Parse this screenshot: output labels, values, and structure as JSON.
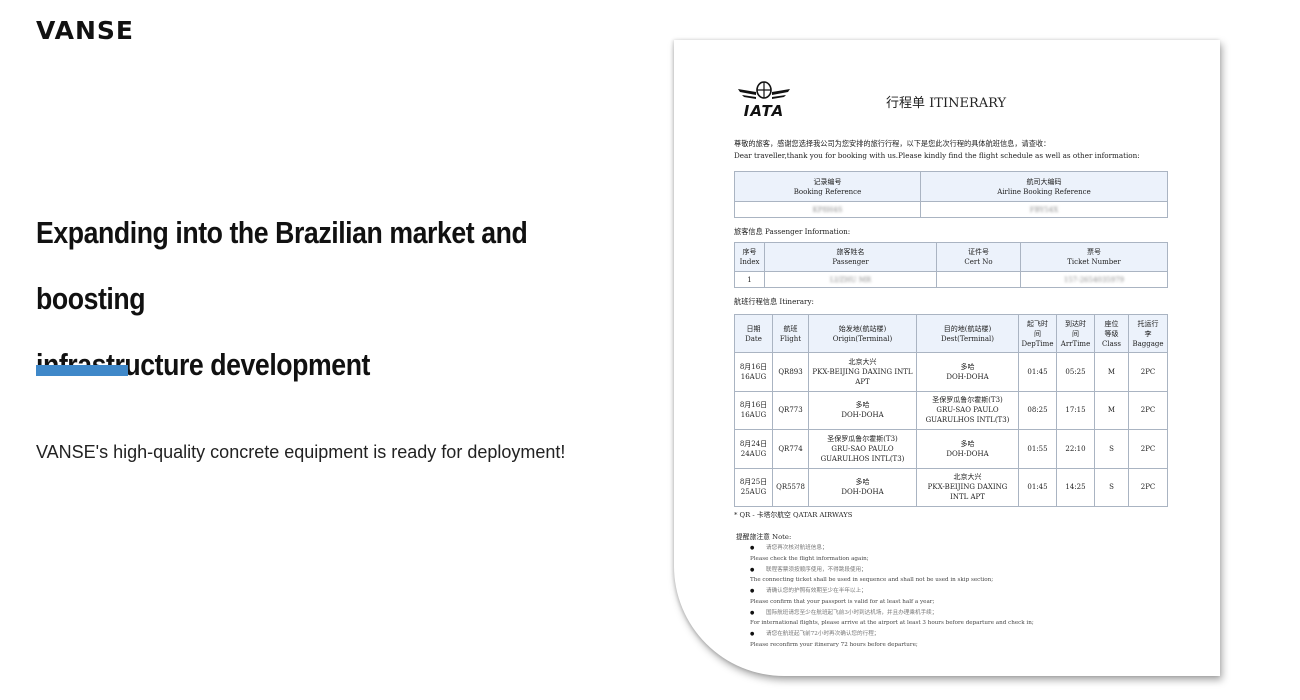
{
  "brand": {
    "logo_text": "VANSE"
  },
  "headline": {
    "line1": "Expanding into the Brazilian market and boosting",
    "line2": "infrastructure development"
  },
  "tagline": "VANSE's high-quality concrete equipment is ready for deployment!",
  "accent_color": "#3f88c9",
  "document": {
    "iata_text": "IATA",
    "title": "行程单  ITINERARY",
    "greeting_zh": "尊敬的旅客，感谢您选择我公司为您安排的旅行行程，以下是您此次行程的具体航班信息，请查收：",
    "greeting_en": "Dear traveller,thank you for booking with us.Please kindly find the flight schedule as well as other information:",
    "booking": {
      "col1_zh": "记录编号",
      "col1_en": "Booking Reference",
      "col2_zh": "航司大编码",
      "col2_en": "Airline Booking Reference",
      "val1": "KP8H4S",
      "val2": "FBY54X"
    },
    "passenger_section": "旅客信息  Passenger Information:",
    "passenger": {
      "h1_zh": "序号",
      "h1_en": "Index",
      "h2_zh": "旅客姓名",
      "h2_en": "Passenger",
      "h3_zh": "证件号",
      "h3_en": "Cert No",
      "h4_zh": "票号",
      "h4_en": "Ticket Number",
      "index": "1",
      "name": "LI/ZHU MR",
      "cert": "",
      "ticket": "157-2654035979"
    },
    "itinerary_section": "航班行程信息  Itinerary:",
    "itinerary_headers": {
      "date_zh": "日期",
      "date_en": "Date",
      "flight_zh": "航班",
      "flight_en": "Flight",
      "origin_zh": "始发地(航站楼)",
      "origin_en": "Origin(Terminal)",
      "dest_zh": "目的地(航站楼)",
      "dest_en": "Dest(Terminal)",
      "dep_zh": "起飞时间",
      "dep_en": "DepTime",
      "arr_zh": "到达时间",
      "arr_en": "ArrTime",
      "class_zh": "座位等级",
      "class_en": "Class",
      "bag_zh": "托运行李",
      "bag_en": "Baggage"
    },
    "flights": [
      {
        "date_zh": "8月16日",
        "date_en": "16AUG",
        "flight": "QR893",
        "origin_zh": "北京大兴",
        "origin_en": "PKX-BEIJING DAXING INTL APT",
        "dest_zh": "多哈",
        "dest_en": "DOH-DOHA",
        "dep": "01:45",
        "arr": "05:25",
        "class": "M",
        "bag": "2PC"
      },
      {
        "date_zh": "8月16日",
        "date_en": "16AUG",
        "flight": "QR773",
        "origin_zh": "多哈",
        "origin_en": "DOH-DOHA",
        "dest_zh": "圣保罗瓜鲁尔霍斯(T3)",
        "dest_en": "GRU-SAO PAULO GUARULHOS INTL(T3)",
        "dep": "08:25",
        "arr": "17:15",
        "class": "M",
        "bag": "2PC"
      },
      {
        "date_zh": "8月24日",
        "date_en": "24AUG",
        "flight": "QR774",
        "origin_zh": "圣保罗瓜鲁尔霍斯(T3)",
        "origin_en": "GRU-SAO PAULO GUARULHOS INTL(T3)",
        "dest_zh": "多哈",
        "dest_en": "DOH-DOHA",
        "dep": "01:55",
        "arr": "22:10",
        "class": "S",
        "bag": "2PC"
      },
      {
        "date_zh": "8月25日",
        "date_en": "25AUG",
        "flight": "QR5578",
        "origin_zh": "多哈",
        "origin_en": "DOH-DOHA",
        "dest_zh": "北京大兴",
        "dest_en": "PKX-BEIJING DAXING INTL APT",
        "dep": "01:45",
        "arr": "14:25",
        "class": "S",
        "bag": "2PC"
      }
    ],
    "airline_note": "* QR - 卡塔尔航空  QATAR AIRWAYS",
    "notes_title": "提醒旅注意  Note:",
    "notes": [
      {
        "zh": "请您再次核对航班信息；",
        "en": "Please check the flight information again;"
      },
      {
        "zh": "联程客票须按顺序使用，不得跳段使用；",
        "en": "The connecting ticket shall be used in sequence and shall not be used in skip section;"
      },
      {
        "zh": "请确认您的护照有效期至少在半年以上；",
        "en": "Please confirm that your passport is valid for at least half a year;"
      },
      {
        "zh": "国际航班请您至少在航班起飞前3小时到达机场，并且办理乘机手续；",
        "en": "For international flights, please arrive at the airport at least 3 hours before departure and check in;"
      },
      {
        "zh": "请您在航班起飞前72小时再次确认您的行程；",
        "en": "Please reconfirm your itinerary 72 hours before departure;"
      }
    ]
  }
}
